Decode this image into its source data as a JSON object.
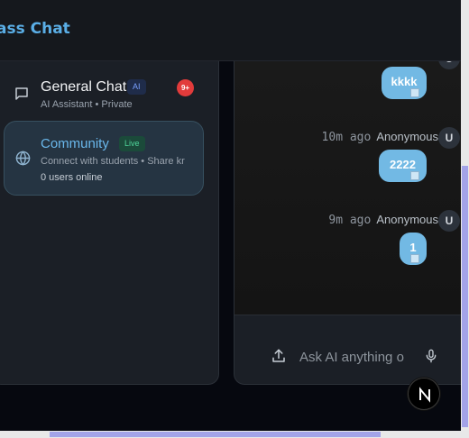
{
  "header": {
    "title": "ass Chat"
  },
  "sidebar": {
    "general_chat": {
      "title": "General Chat",
      "badge": "AI",
      "subtitle": "AI Assistant • Private",
      "unread_count": "9+",
      "icon": "chat-bubble-icon"
    },
    "community": {
      "title": "Community",
      "badge": "Live",
      "subtitle": "Connect with students • Share kr",
      "online": "0 users online",
      "icon": "globe-icon"
    }
  },
  "chat": {
    "messages": [
      {
        "time": "",
        "sender": "",
        "avatar": "U",
        "text": "kkkk"
      },
      {
        "time": "10m ago",
        "sender": "Anonymous",
        "avatar": "U",
        "text": "2222"
      },
      {
        "time": "9m ago",
        "sender": "Anonymous",
        "avatar": "U",
        "text": "1"
      }
    ],
    "input": {
      "value": "",
      "placeholder": "Ask AI anything o"
    }
  },
  "fab": {
    "label": "N"
  },
  "colors": {
    "accent": "#5aaee6",
    "bubble": "#72b9e4",
    "unread_badge": "#e23b3b",
    "live_badge": "#4fd49a",
    "ai_badge": "#78a0ff"
  }
}
